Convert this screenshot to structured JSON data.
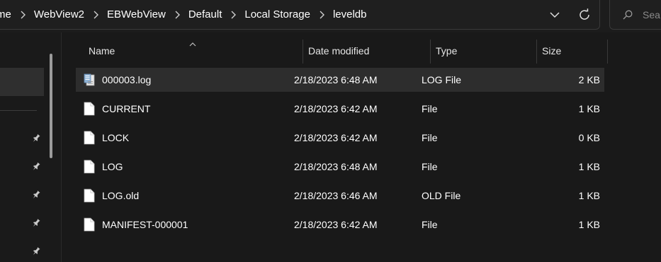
{
  "address_bar": {
    "breadcrumbs": [
      "me",
      "WebView2",
      "EBWebView",
      "Default",
      "Local Storage",
      "leveldb"
    ]
  },
  "search": {
    "placeholder": "Sea"
  },
  "columns": {
    "name": "Name",
    "date": "Date modified",
    "type": "Type",
    "size": "Size"
  },
  "files": [
    {
      "name": "000003.log",
      "date": "2/18/2023 6:48 AM",
      "type": "LOG File",
      "size": "2 KB",
      "icon": "log-file-icon",
      "selected": true
    },
    {
      "name": "CURRENT",
      "date": "2/18/2023 6:42 AM",
      "type": "File",
      "size": "1 KB",
      "icon": "file-icon"
    },
    {
      "name": "LOCK",
      "date": "2/18/2023 6:42 AM",
      "type": "File",
      "size": "0 KB",
      "icon": "file-icon"
    },
    {
      "name": "LOG",
      "date": "2/18/2023 6:48 AM",
      "type": "File",
      "size": "1 KB",
      "icon": "file-icon"
    },
    {
      "name": "LOG.old",
      "date": "2/18/2023 6:46 AM",
      "type": "OLD File",
      "size": "1 KB",
      "icon": "file-icon"
    },
    {
      "name": "MANIFEST-000001",
      "date": "2/18/2023 6:42 AM",
      "type": "File",
      "size": "1 KB",
      "icon": "file-icon"
    }
  ],
  "colors": {
    "background": "#191919",
    "selected_row": "#2d2d2d",
    "text": "#ffffff"
  }
}
